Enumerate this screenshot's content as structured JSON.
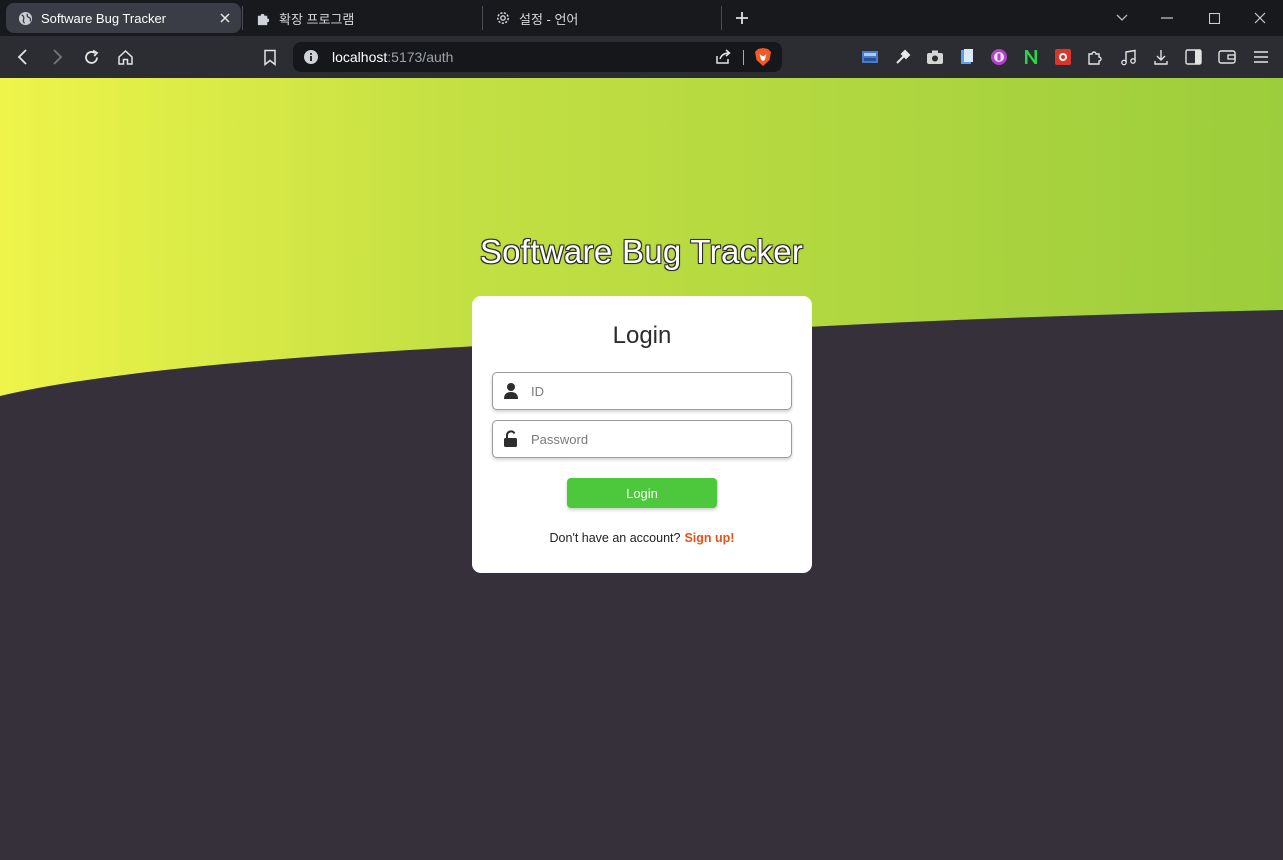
{
  "browser": {
    "tabs": [
      {
        "title": "Software Bug Tracker",
        "icon": "globe-icon",
        "active": true
      },
      {
        "title": "확장 프로그램",
        "icon": "puzzle-icon",
        "active": false
      },
      {
        "title": "설정 - 언어",
        "icon": "gear-icon",
        "active": false
      }
    ],
    "url_host": "localhost",
    "url_rest": ":5173/auth"
  },
  "page": {
    "app_title": "Software Bug Tracker",
    "card_title": "Login",
    "id_placeholder": "ID",
    "password_placeholder": "Password",
    "login_button": "Login",
    "signup_prompt": "Don't have an account?",
    "signup_link": "Sign up!"
  },
  "colors": {
    "accent_green": "#4dc73c",
    "signup_link": "#e0541a",
    "background_dark": "#35303a",
    "gradient_yellow": "#eef44a",
    "gradient_green": "#9ccd3c"
  }
}
